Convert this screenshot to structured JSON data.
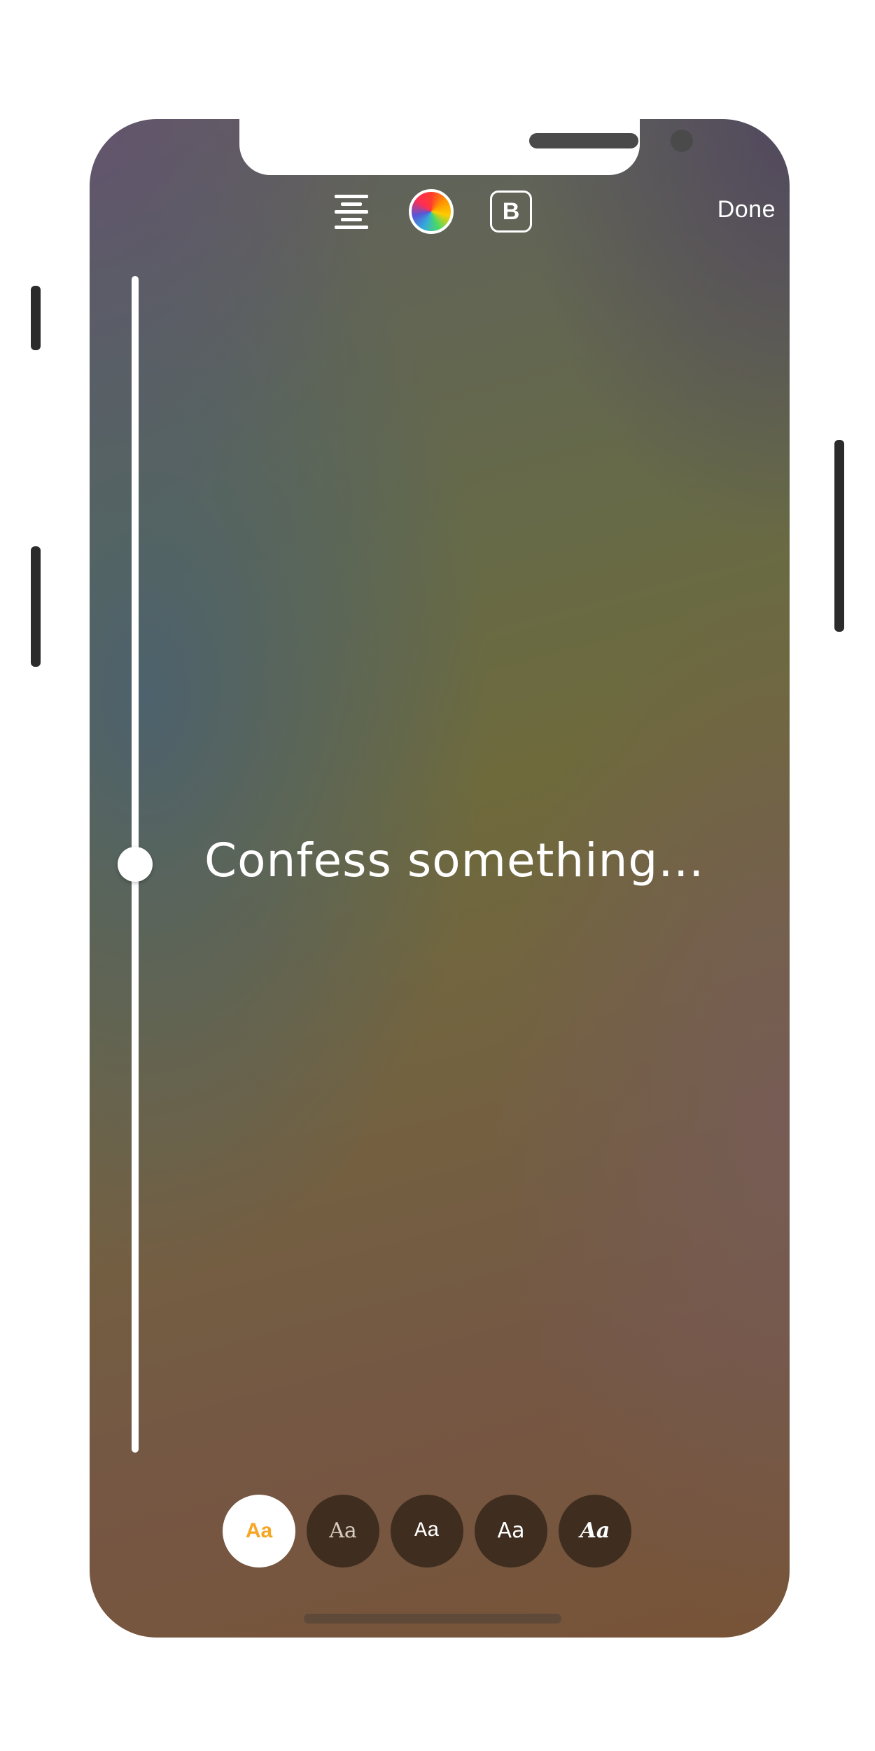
{
  "toolbar": {
    "align_icon": "align-center-icon",
    "color_icon": "color-wheel-icon",
    "bold_icon": "bold-icon",
    "bold_label": "B",
    "done_label": "Done"
  },
  "slider": {
    "icon": "text-size-slider",
    "value_fraction_from_top": 0.5
  },
  "text_input": {
    "placeholder": "Confess something..."
  },
  "font_picker": {
    "fonts": [
      {
        "label": "Aa",
        "style": "classic",
        "selected": true
      },
      {
        "label": "Aa",
        "style": "serif",
        "selected": false
      },
      {
        "label": "Aa",
        "style": "typewriter",
        "selected": false
      },
      {
        "label": "Aa",
        "style": "modern",
        "selected": false
      },
      {
        "label": "Aa",
        "style": "strong",
        "selected": false
      }
    ]
  },
  "colors": {
    "accent": "#F5A623",
    "font_button_bg": "#3F2E20",
    "foreground": "#FFFFFF"
  }
}
